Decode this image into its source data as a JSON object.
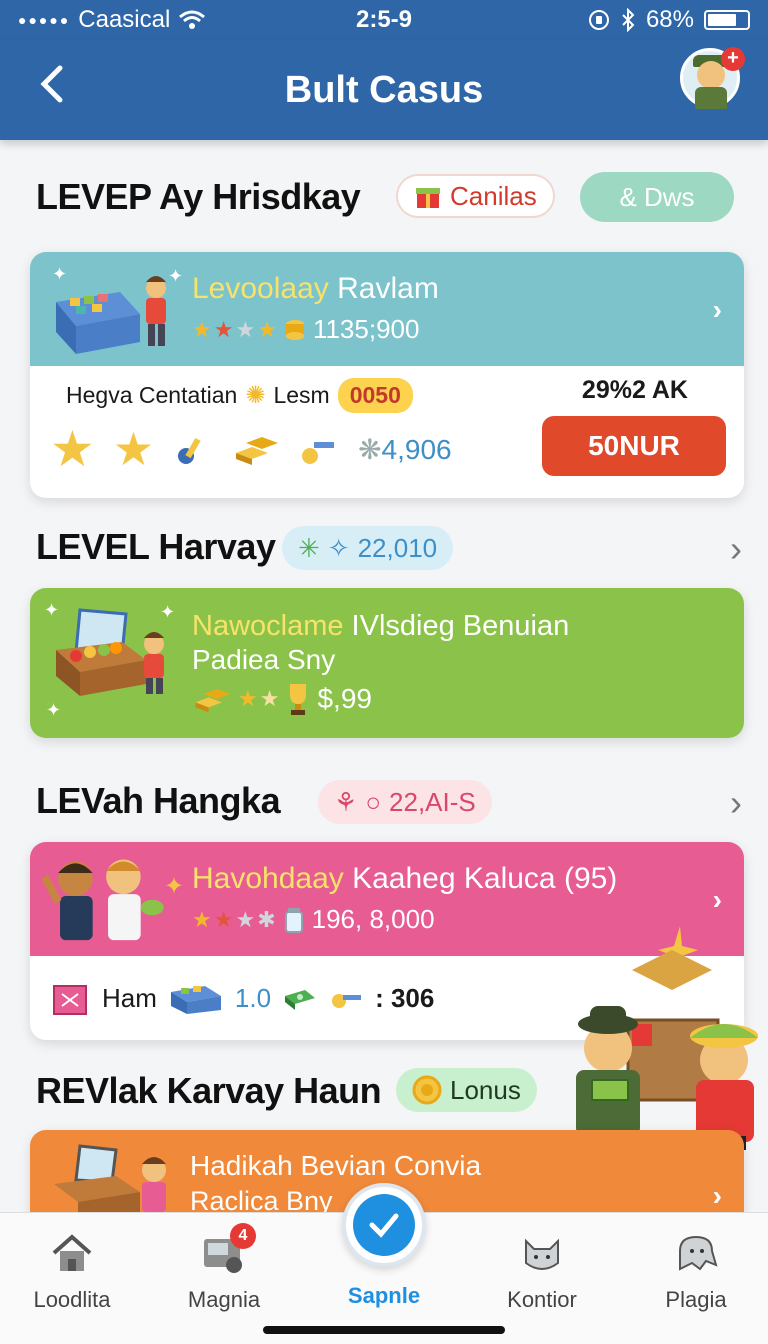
{
  "status": {
    "carrier": "Caasical",
    "time": "2:5-9",
    "battery": "68%"
  },
  "header": {
    "title": "Bult Casus"
  },
  "sections": [
    {
      "title": "LEVEP Ay Hrisdkay",
      "pill1": "Canilas",
      "pill2": "& Dws",
      "card": {
        "title_a": "Levoolaay",
        "title_b": " Ravlam",
        "value": "1135;900",
        "row1_label": "Hegva Centatian",
        "row1_label2": "Lesm",
        "row1_pill": "0050",
        "row1_right": "29%2 AK",
        "row2_value": "4,906",
        "button": "50NUR"
      }
    },
    {
      "title": "LEVEL Harvay",
      "pill": "22,010",
      "card": {
        "line1_a": "Nawoclame",
        "line1_b": " IVlsdieg Benuian",
        "line2": "Padiea Sny",
        "price": "$,99"
      }
    },
    {
      "title": "LEVah Hangka",
      "pill": "22,AI-S",
      "card": {
        "title_a": "Havohdaay",
        "title_b": " Kaaheg Kaluca (95)",
        "value": "196, 8,000",
        "row_label": "Ham",
        "row_value1": "1.0",
        "row_value2": ": 306"
      }
    },
    {
      "title": "REVlak Karvay Haun",
      "pill": "Lonus",
      "card": {
        "line1": "Hadikah Bevian Convia",
        "line2": "Raclica Bny"
      }
    }
  ],
  "tabs": [
    {
      "label": "Loodlita"
    },
    {
      "label": "Magnia",
      "badge": "4"
    },
    {
      "label": "Sapnle"
    },
    {
      "label": "Kontior"
    },
    {
      "label": "Plagia"
    }
  ],
  "colors": {
    "header": "#2f66a8",
    "teal": "#7cc3cc",
    "green": "#8bc34a",
    "pink": "#e75c93",
    "orange": "#f0893a",
    "accent": "#1f8fe0"
  }
}
